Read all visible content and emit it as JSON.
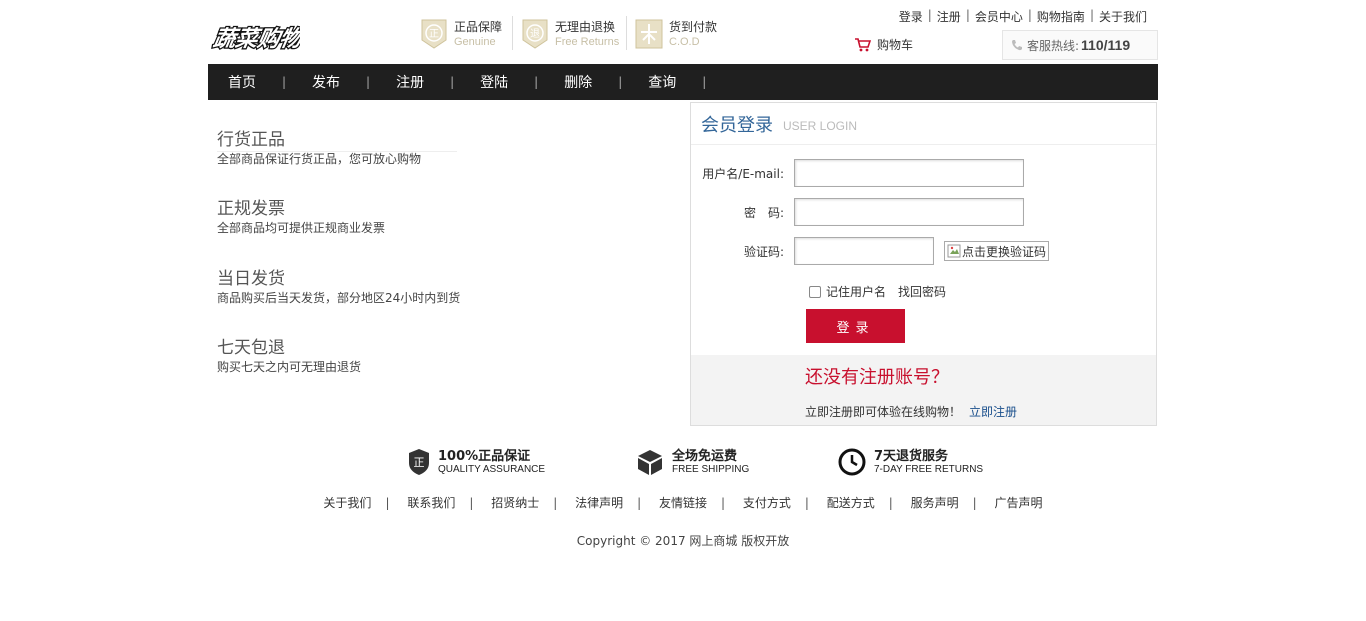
{
  "header": {
    "logo_text": "蔬菜购物",
    "promises": [
      {
        "cn": "正品保障",
        "en": "Genuine",
        "icon": "seal-zheng-icon",
        "glyph": "正"
      },
      {
        "cn": "无理由退换",
        "en": "Free Returns",
        "icon": "seal-tui-icon",
        "glyph": "退"
      },
      {
        "cn": "货到付款",
        "en": "C.O.D",
        "icon": "seal-cod-icon",
        "glyph": "付"
      }
    ],
    "top_links": [
      "登录",
      "注册",
      "会员中心",
      "购物指南",
      "关于我们"
    ],
    "cart_label": "购物车",
    "hotline_label": "客服热线:",
    "hotline_number": "110/119"
  },
  "nav": {
    "items": [
      "首页",
      "发布",
      "注册",
      "登陆",
      "删除",
      "查询"
    ],
    "separator": "|"
  },
  "features": [
    {
      "title": "行货正品",
      "desc": "全部商品保证行货正品，您可放心购物"
    },
    {
      "title": "正规发票",
      "desc": "全部商品均可提供正规商业发票"
    },
    {
      "title": "当日发货",
      "desc": "商品购买后当天发货，部分地区24小时内到货"
    },
    {
      "title": "七天包退",
      "desc": "购买七天之内可无理由退货"
    }
  ],
  "login": {
    "title_cn": "会员登录",
    "title_en": "USER LOGIN",
    "username_label": "用户名/E-mail:",
    "username_value": "",
    "password_label": "密　码:",
    "password_value": "",
    "captcha_label": "验证码:",
    "captcha_value": "",
    "captcha_image_alt": "点击更换验证码",
    "remember_label": "记住用户名",
    "remember_checked": false,
    "forgot_label": "找回密码",
    "submit_label": "登录",
    "no_account": "还没有注册账号？",
    "register_tip": "立即注册即可体验在线购物！",
    "register_link": "立即注册"
  },
  "services": [
    {
      "cn": "100%正品保证",
      "en": "QUALITY ASSURANCE",
      "icon": "shield-zheng-icon",
      "glyph": "正"
    },
    {
      "cn": "全场免运费",
      "en": "FREE SHIPPING",
      "icon": "box-icon"
    },
    {
      "cn": "7天退货服务",
      "en": "7-DAY FREE RETURNS",
      "icon": "clock-icon"
    }
  ],
  "footer_links": [
    "关于我们",
    "联系我们",
    "招贤纳士",
    "法律声明",
    "友情链接",
    "支付方式",
    "配送方式",
    "服务声明",
    "广告声明"
  ],
  "copyright": "Copyright © 2017 网上商城 版权开放",
  "colors": {
    "nav_bg": "#1f1f1f",
    "accent_red": "#c8102e",
    "title_blue": "#336699",
    "link_blue": "#1a4f8c"
  }
}
